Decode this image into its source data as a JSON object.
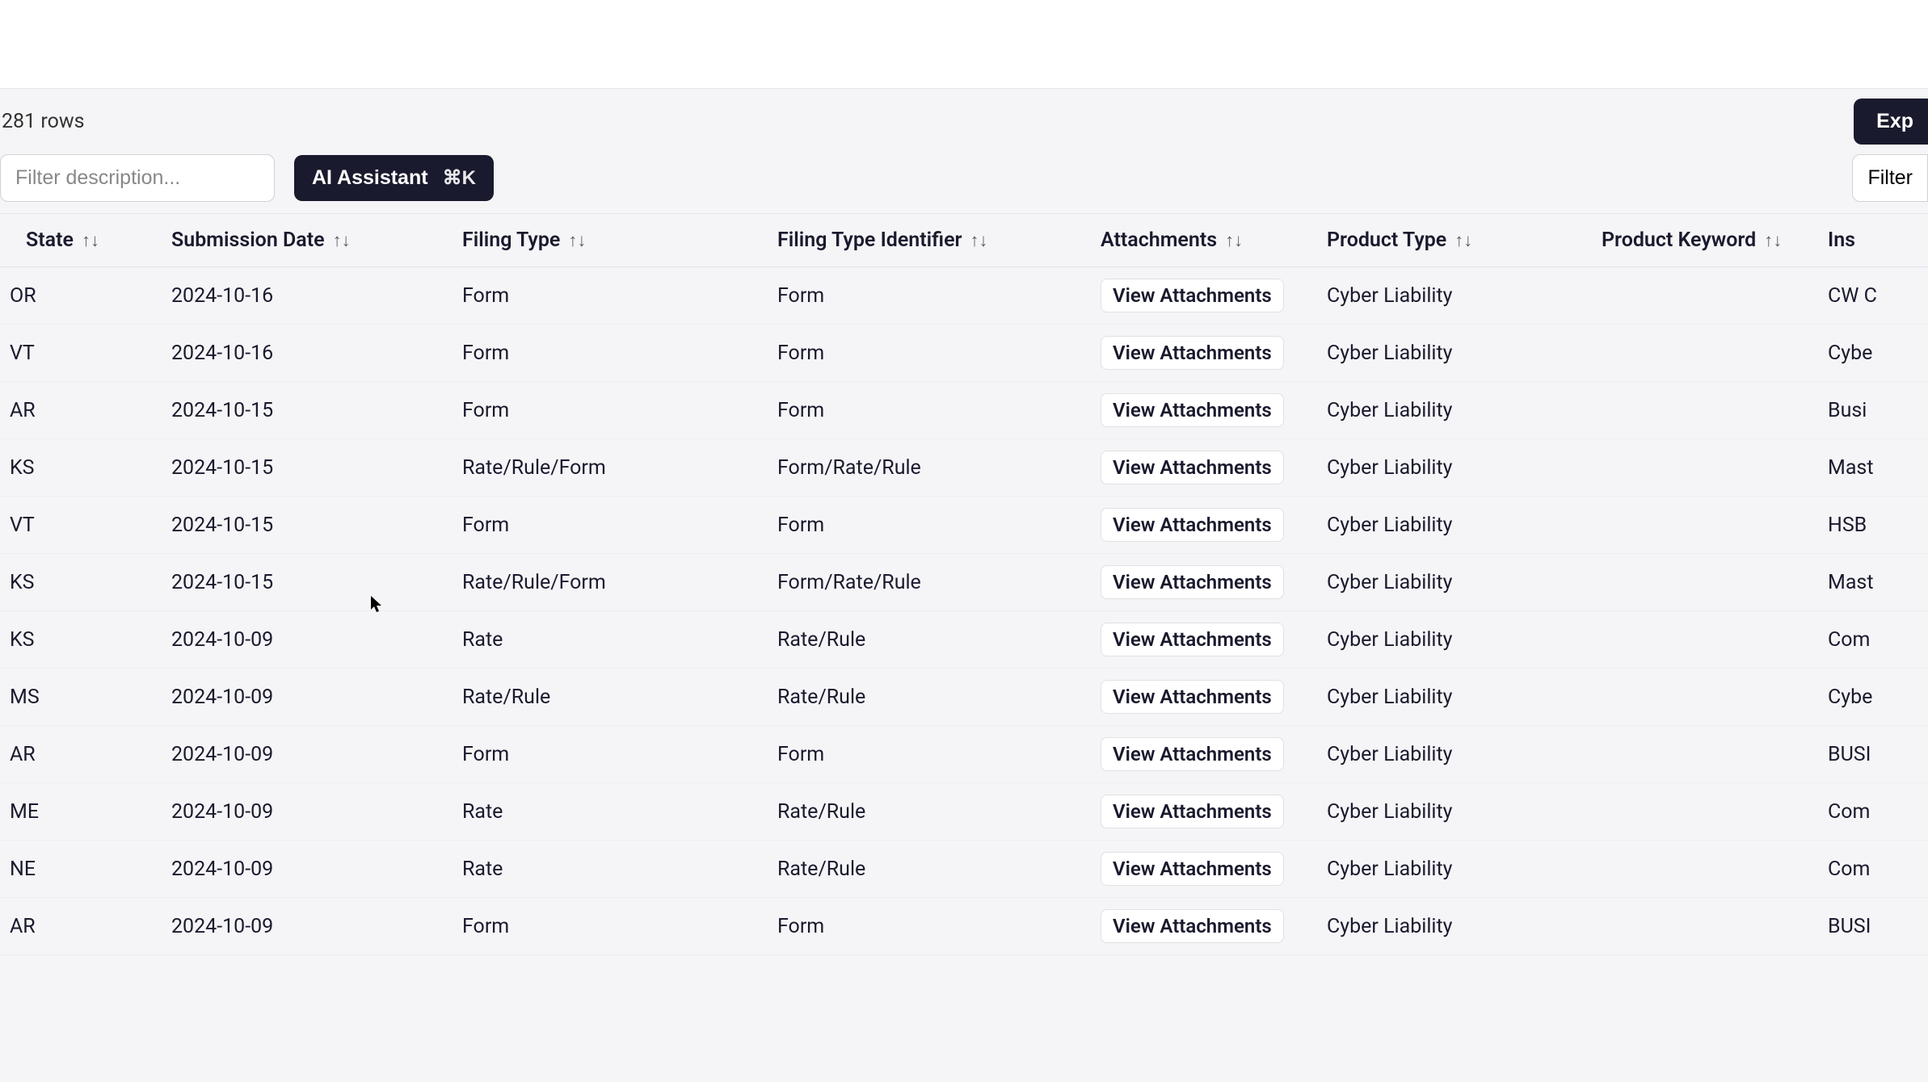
{
  "toolbar": {
    "row_count": "281 rows",
    "export_label": "Exp",
    "filter_placeholder": "Filter description...",
    "ai_label": "AI Assistant",
    "ai_kbd": "⌘K",
    "filters_label": "Filter"
  },
  "columns": [
    {
      "label": "State"
    },
    {
      "label": "Submission Date"
    },
    {
      "label": "Filing Type"
    },
    {
      "label": "Filing Type Identifier"
    },
    {
      "label": "Attachments"
    },
    {
      "label": "Product Type"
    },
    {
      "label": "Product Keyword"
    },
    {
      "label": "Ins"
    }
  ],
  "attachments_button": "View Attachments",
  "rows": [
    {
      "state": "OR",
      "date": "2024-10-16",
      "ftype": "Form",
      "ftid": "Form",
      "ptype": "Cyber Liability",
      "pkw": "",
      "ins": "CW C"
    },
    {
      "state": "VT",
      "date": "2024-10-16",
      "ftype": "Form",
      "ftid": "Form",
      "ptype": "Cyber Liability",
      "pkw": "",
      "ins": "Cybe"
    },
    {
      "state": "AR",
      "date": "2024-10-15",
      "ftype": "Form",
      "ftid": "Form",
      "ptype": "Cyber Liability",
      "pkw": "",
      "ins": "Busi"
    },
    {
      "state": "KS",
      "date": "2024-10-15",
      "ftype": "Rate/Rule/Form",
      "ftid": "Form/Rate/Rule",
      "ptype": "Cyber Liability",
      "pkw": "",
      "ins": "Mast"
    },
    {
      "state": "VT",
      "date": "2024-10-15",
      "ftype": "Form",
      "ftid": "Form",
      "ptype": "Cyber Liability",
      "pkw": "",
      "ins": "HSB"
    },
    {
      "state": "KS",
      "date": "2024-10-15",
      "ftype": "Rate/Rule/Form",
      "ftid": "Form/Rate/Rule",
      "ptype": "Cyber Liability",
      "pkw": "",
      "ins": "Mast"
    },
    {
      "state": "KS",
      "date": "2024-10-09",
      "ftype": "Rate",
      "ftid": "Rate/Rule",
      "ptype": "Cyber Liability",
      "pkw": "",
      "ins": "Com"
    },
    {
      "state": "MS",
      "date": "2024-10-09",
      "ftype": "Rate/Rule",
      "ftid": "Rate/Rule",
      "ptype": "Cyber Liability",
      "pkw": "",
      "ins": "Cybe"
    },
    {
      "state": "AR",
      "date": "2024-10-09",
      "ftype": "Form",
      "ftid": "Form",
      "ptype": "Cyber Liability",
      "pkw": "",
      "ins": "BUSI"
    },
    {
      "state": "ME",
      "date": "2024-10-09",
      "ftype": "Rate",
      "ftid": "Rate/Rule",
      "ptype": "Cyber Liability",
      "pkw": "",
      "ins": "Com"
    },
    {
      "state": "NE",
      "date": "2024-10-09",
      "ftype": "Rate",
      "ftid": "Rate/Rule",
      "ptype": "Cyber Liability",
      "pkw": "",
      "ins": "Com"
    },
    {
      "state": "AR",
      "date": "2024-10-09",
      "ftype": "Form",
      "ftid": "Form",
      "ptype": "Cyber Liability",
      "pkw": "",
      "ins": "BUSI"
    }
  ]
}
